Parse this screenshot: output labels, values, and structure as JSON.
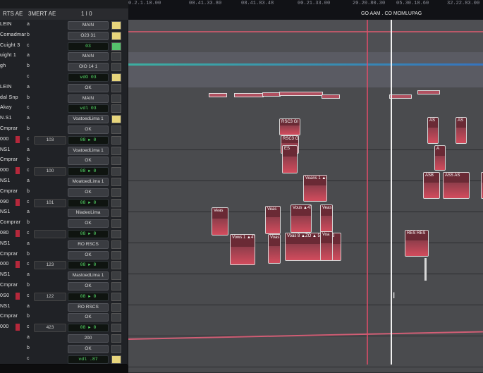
{
  "header": {
    "col1": "RTS AE",
    "col2": "3MERT AE",
    "col3": "1 I 0"
  },
  "ruler": {
    "ticks": [
      "0.2.1.10.00",
      "00.41.33.80",
      "08.41.83.48",
      "00.21.33.00",
      "20.20.80.30",
      "05.30.18.60",
      "32.22.83.00"
    ],
    "event_label": "GO AAM . CO MOMLUPAG"
  },
  "tracks": [
    {
      "label": "LEIN",
      "chan": "a",
      "sel": "MAIN",
      "side": "y"
    },
    {
      "label": "Comadmar",
      "chan": "b",
      "sel": "O23 31",
      "side": "y"
    },
    {
      "label": "Cuight 3",
      "chan": "c",
      "green": "03",
      "side": "g"
    },
    {
      "label": "uight 1",
      "chan": "a",
      "sel": "MAIN",
      "side": ""
    },
    {
      "label": "gh",
      "chan": "b",
      "sel": "OIO 14 1",
      "side": ""
    },
    {
      "label": "",
      "chan": "c",
      "green": "vdO       03",
      "side": "y"
    },
    {
      "label": "LEIN",
      "chan": "a",
      "sel": "OK",
      "side": ""
    },
    {
      "label": "dal Snp",
      "chan": "b",
      "sel": "MAIN",
      "side": ""
    },
    {
      "label": "Akay",
      "chan": "c",
      "green": "vdl       03",
      "side": ""
    },
    {
      "label": "N.S1",
      "chan": "a",
      "sel": "VoatoedLima 1",
      "side": "y"
    },
    {
      "label": "Cmprar",
      "chan": "b",
      "sel": "OK",
      "side": ""
    },
    {
      "label": "000",
      "chan": "c",
      "num": "103",
      "green": "08 ▸ 0",
      "side": ""
    },
    {
      "label": "NS1",
      "chan": "a",
      "sel": "VoatoedLima 1",
      "side": ""
    },
    {
      "label": "Cmprar",
      "chan": "b",
      "sel": "OK",
      "side": ""
    },
    {
      "label": "000",
      "chan": "c",
      "num": "100",
      "green": "08 ▸ 0",
      "side": ""
    },
    {
      "label": "NS1",
      "chan": "a",
      "sel": "MoatoedLima 1",
      "side": ""
    },
    {
      "label": "Cmprar",
      "chan": "b",
      "sel": "OK",
      "side": ""
    },
    {
      "label": "090",
      "chan": "c",
      "num": "101",
      "green": "08 ▸ 0",
      "side": ""
    },
    {
      "label": "NS1",
      "chan": "a",
      "sel": "NladeoLima",
      "side": ""
    },
    {
      "label": "Comprar",
      "chan": "b",
      "sel": "OK",
      "side": ""
    },
    {
      "label": "080",
      "chan": "c",
      "num": "",
      "green": "08 ▸ 0",
      "side": ""
    },
    {
      "label": "NS1",
      "chan": "a",
      "sel": "RO RSCS",
      "side": ""
    },
    {
      "label": "Cmprar",
      "chan": "b",
      "sel": "OK",
      "side": ""
    },
    {
      "label": "000",
      "chan": "c",
      "num": "123",
      "green": "08 ▸ 0",
      "side": ""
    },
    {
      "label": "NS1",
      "chan": "a",
      "sel": "MastoedLima 1",
      "side": ""
    },
    {
      "label": "Cmprar",
      "chan": "b",
      "sel": "OK",
      "side": ""
    },
    {
      "label": "0S0",
      "chan": "c",
      "num": "122",
      "green": "08 ▸ 0",
      "side": ""
    },
    {
      "label": "NS1",
      "chan": "a",
      "sel": "RO RSCS",
      "side": ""
    },
    {
      "label": "Cmprar",
      "chan": "b",
      "sel": "OK",
      "side": ""
    },
    {
      "label": "000",
      "chan": "c",
      "num": "423",
      "green": "08 ▸ 0",
      "side": ""
    },
    {
      "label": "",
      "chan": "a",
      "sel": "200",
      "side": ""
    },
    {
      "label": "",
      "chan": "b",
      "sel": "OK",
      "side": ""
    },
    {
      "label": "",
      "chan": "c",
      "green": "vdl      .87",
      "side": "y"
    }
  ],
  "clips": [
    {
      "label": "RSC3 GI   ▲4T 6"
    },
    {
      "label": "RSC3 GI"
    },
    {
      "label": "ES"
    },
    {
      "label": "Voans 1   ▲4T 6"
    },
    {
      "label": "Veas"
    },
    {
      "label": "Veas"
    },
    {
      "label": "Vous   ▲4T 6"
    },
    {
      "label": "Veas"
    },
    {
      "label": "Vows 1   ▲4T 8"
    },
    {
      "label": "Voas"
    },
    {
      "label": "Voas 8  ▲ZO   ▲ 5 3   5 P 3"
    },
    {
      "label": "Voa"
    },
    {
      "label": "RES RES"
    },
    {
      "label": "AS"
    },
    {
      "label": "AS"
    },
    {
      "label": "A"
    },
    {
      "label": "ASB"
    },
    {
      "label": "ASS AS"
    },
    {
      "label": "A"
    }
  ],
  "colors": {
    "accent_green": "#57e06a",
    "clip_red": "#6a2a35",
    "playhead": "#f1f1f1",
    "loop_marker": "#ff5070"
  }
}
